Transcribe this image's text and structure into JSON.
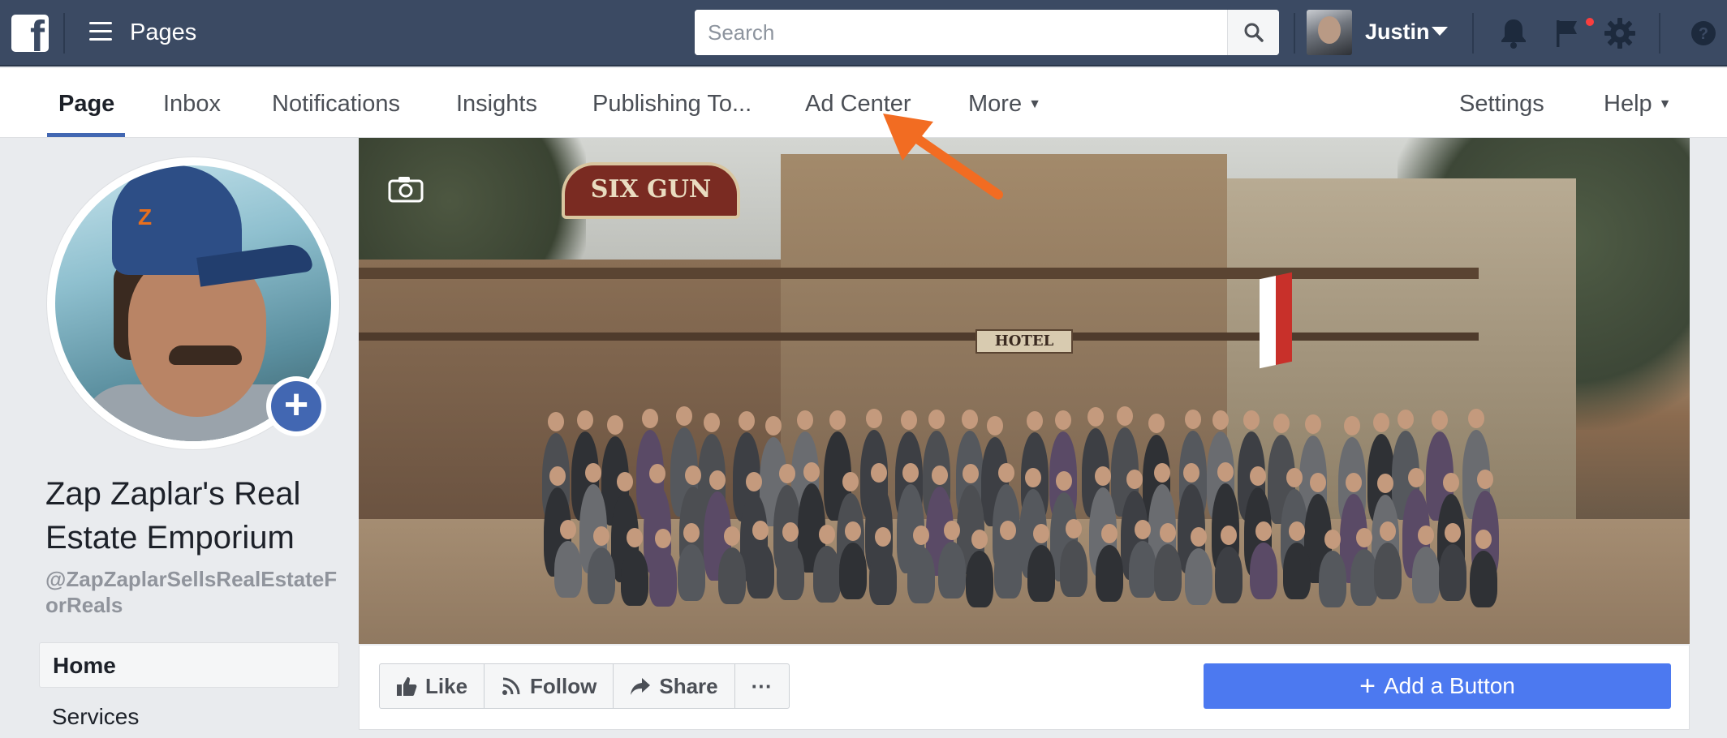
{
  "topbar": {
    "logo": "f",
    "section_title": "Pages",
    "search_placeholder": "Search",
    "user_name": "Justin"
  },
  "tabs": [
    {
      "label": "Page"
    },
    {
      "label": "Inbox"
    },
    {
      "label": "Notifications"
    },
    {
      "label": "Insights"
    },
    {
      "label": "Publishing To..."
    },
    {
      "label": "Ad Center"
    },
    {
      "label": "More"
    },
    {
      "label": "Settings"
    },
    {
      "label": "Help"
    }
  ],
  "page": {
    "name": "Zap Zaplar's Real Estate Emporium",
    "handle": "@ZapZaplarSellsRealEstateForReals",
    "profile_logo": "Z"
  },
  "left_nav": {
    "home": "Home",
    "services": "Services"
  },
  "cover": {
    "sign_text": "SIX GUN",
    "hotel_sign": "HOTEL"
  },
  "actions": {
    "like": "Like",
    "follow": "Follow",
    "share": "Share",
    "more": "···",
    "add_button": "Add a Button"
  },
  "colors": {
    "topbar": "#3b4a63",
    "accent": "#4267b2",
    "cta": "#4c79f0",
    "annotation_arrow": "#f26c22"
  }
}
